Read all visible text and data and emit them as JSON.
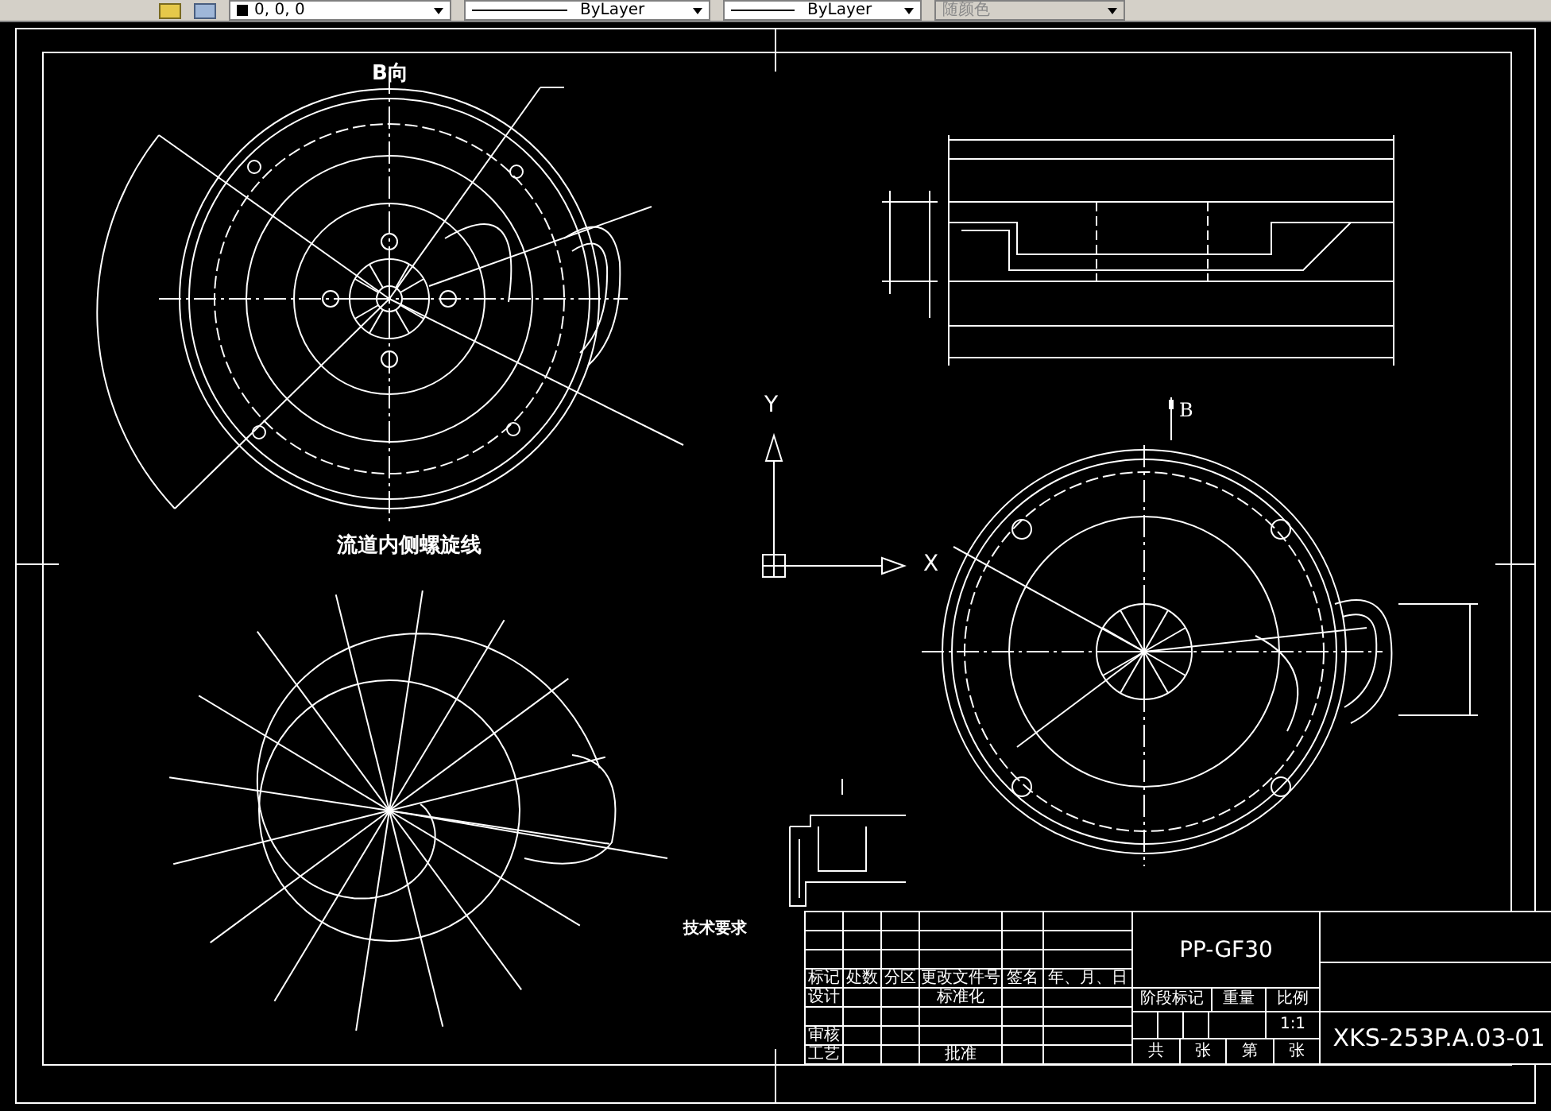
{
  "toolbar": {
    "color_dropdown": "0, 0, 0",
    "linetype_dropdown": "ByLayer",
    "lineweight_dropdown": "ByLayer",
    "plotstyle_dropdown": {
      "value": "随颜色",
      "disabled": true
    }
  },
  "views": {
    "top_view_label": "B向",
    "spiral_label": "流道内侧螺旋线",
    "view_arrow_label": "B"
  },
  "ucs": {
    "y_label": "Y",
    "x_label": "X"
  },
  "notes_title": "技术要求",
  "title_block": {
    "header_labels": [
      "标记",
      "处数",
      "分区",
      "更改文件号",
      "签名",
      "年、月、日"
    ],
    "design": "设计",
    "standardization": "标准化",
    "review": "审核",
    "process": "工艺",
    "approval": "批准",
    "material": "PP-GF30",
    "stage_labels": [
      "阶段标记",
      "重量",
      "比例"
    ],
    "scale": "1:1",
    "sheet_labels": [
      "共",
      "张",
      "第",
      "张"
    ],
    "drawing_number": "XKS-253P.A.03-01"
  }
}
